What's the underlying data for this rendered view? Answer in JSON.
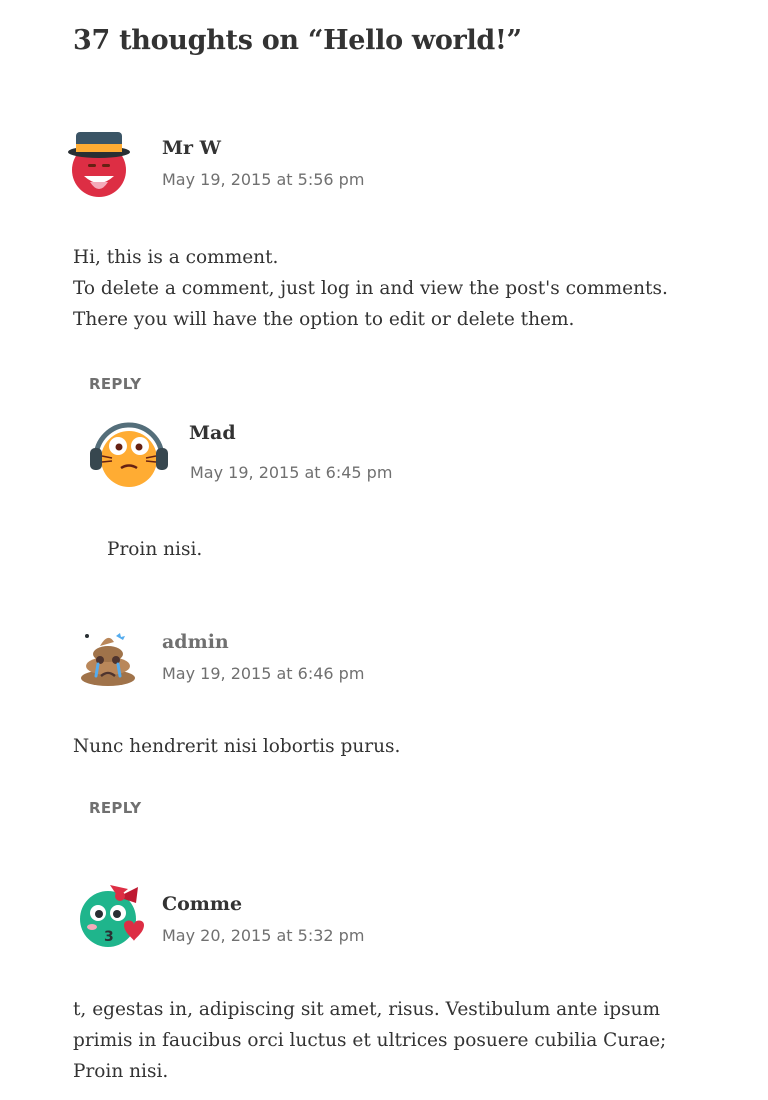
{
  "comments_title": "37 thoughts on “Hello world!”",
  "comments": [
    {
      "author": "Mr W",
      "date": "May 19, 2015 at 5:56 pm",
      "body_lines": [
        "Hi, this is a comment.",
        "To delete a comment, just log in and view the post's comments. There you will have the option to edit or delete them."
      ],
      "reply_label": "REPLY",
      "avatar_icon": "red-face-top-hat-icon"
    },
    {
      "author": "Mad",
      "date": "May 19, 2015 at 6:45 pm",
      "body_lines": [
        "Proin nisi."
      ],
      "avatar_icon": "cat-headphones-icon"
    },
    {
      "author": "admin",
      "date": "May 19, 2015 at 6:46 pm",
      "body_lines": [
        "Nunc hendrerit nisi lobortis purus."
      ],
      "reply_label": "REPLY",
      "avatar_icon": "crying-poop-icon"
    },
    {
      "author": "Comme",
      "date": "May 20, 2015 at 5:32 pm",
      "body_lines": [
        "t, egestas in, adipiscing sit amet, risus. Vestibulum ante ipsum primis in faucibus orci luctus et ultrices posuere cubilia Curae; Proin nisi."
      ],
      "avatar_icon": "kissing-bow-face-icon"
    }
  ],
  "colors": {
    "text": "#333333",
    "meta": "#707070",
    "background": "#ffffff"
  }
}
